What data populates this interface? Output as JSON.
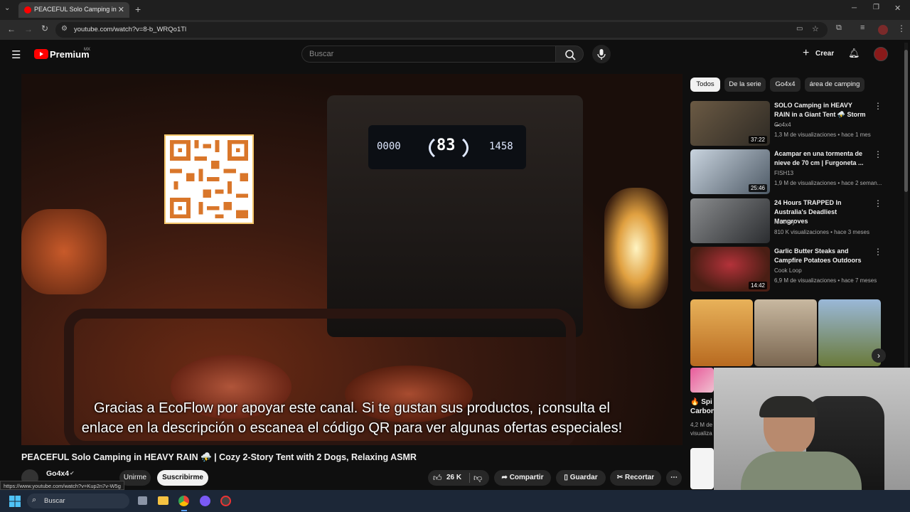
{
  "browser": {
    "tab_title": "PEACEFUL Solo Camping in HE",
    "tab_close": "✕",
    "new_tab": "+",
    "url": "youtube.com/watch?v=8-b_WRQo1Tl",
    "status_url": "https://www.youtube.com/watch?v=Kup2n7v-W5g"
  },
  "header": {
    "logo_text": "Premium",
    "region": "MX",
    "search_placeholder": "Buscar",
    "create_label": "Crear"
  },
  "video": {
    "caption_line1": "Gracias a EcoFlow por apoyar este canal. Si te gustan sus productos, ¡consulta el",
    "caption_line2": "enlace en la descripción o escanea el código QR para ver algunas ofertas especiales!",
    "lcd_left": "0000",
    "lcd_center": "83",
    "lcd_right": "1458",
    "title": "PEACEFUL Solo Camping in HEAVY RAIN ⛈️ | Cozy 2-Story Tent with 2 Dogs, Relaxing ASMR",
    "channel": "Go4x4",
    "join_label": "Unirme",
    "subscribe_label": "Suscribirme",
    "likes": "26 K",
    "share_label": "Compartir",
    "save_label": "Guardar",
    "clip_label": "Recortar"
  },
  "chips": [
    {
      "label": "Todos"
    },
    {
      "label": "De la serie"
    },
    {
      "label": "Go4x4"
    },
    {
      "label": "área de camping"
    }
  ],
  "recommendations": [
    {
      "title": "SOLO Camping in HEAVY RAIN in a Giant Tent ⛈️ Storm ...",
      "channel": "Go4x4",
      "meta": "1,3 M de visualizaciones • hace 1 mes",
      "duration": "37:22"
    },
    {
      "title": "Acampar en una tormenta de nieve de 70 cm | Furgoneta ...",
      "channel": "FISH13",
      "meta": "1,9 M de visualizaciones • hace 2 seman...",
      "duration": "25:46"
    },
    {
      "title": "24 Hours TRAPPED In Australia's Deadliest Mangroves",
      "channel": "Nick Fry",
      "meta": "810 K visualizaciones • hace 3 meses",
      "duration": ""
    },
    {
      "title": "Garlic Butter Steaks and Campfire Potatoes Outdoors",
      "channel": "Cook Loop",
      "meta": "6,9 M de visualizaciones • hace 7 meses",
      "duration": "14:42"
    }
  ],
  "shorts_partial": {
    "title_line1": "🔥 Spi",
    "title_line2": "Carbon",
    "meta_line1": "4,2 M de",
    "meta_line2": "visualiza"
  },
  "taskbar": {
    "search_label": "Buscar"
  }
}
